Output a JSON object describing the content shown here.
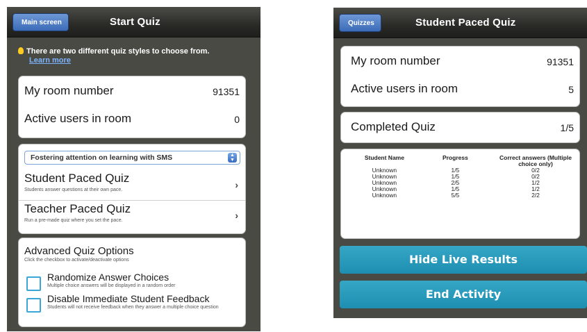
{
  "left_screen": {
    "nav": {
      "back_label": "Main screen",
      "title": "Start Quiz"
    },
    "tip": {
      "text": "There are two different quiz styles to choose from.",
      "link": "Learn more"
    },
    "room": {
      "room_number_label": "My room number",
      "room_number_value": "91351",
      "active_users_label": "Active users in room",
      "active_users_value": "0"
    },
    "quiz_select": {
      "selected": "Fostering attention on learning with SMS"
    },
    "student_paced": {
      "title": "Student Paced Quiz",
      "subtitle": "Students answer questions at their own pace."
    },
    "teacher_paced": {
      "title": "Teacher Paced Quiz",
      "subtitle": "Run a pre-made quiz where you set the pace."
    },
    "advanced": {
      "title": "Advanced Quiz Options",
      "subtitle": "Click the checkbox to activate/deactivate options",
      "options": [
        {
          "title": "Randomize Answer Choices",
          "desc": "Multiple choice answers will be displayed in a random order",
          "checked": false
        },
        {
          "title": "Disable Immediate Student Feedback",
          "desc": "Students will not receive feedback when they answer a multiple choice question",
          "checked": false
        }
      ]
    }
  },
  "right_screen": {
    "nav": {
      "back_label": "Quizzes",
      "title": "Student Paced Quiz"
    },
    "room": {
      "room_number_label": "My room number",
      "room_number_value": "91351",
      "active_users_label": "Active users in room",
      "active_users_value": "5"
    },
    "completed": {
      "label": "Completed Quiz",
      "value": "1/5"
    },
    "results": {
      "headers": [
        "Student Name",
        "Progress",
        "Correct answers (Multiple choice only)"
      ],
      "rows": [
        [
          "Unknown",
          "1/5",
          "0/2"
        ],
        [
          "Unknown",
          "1/5",
          "0/2"
        ],
        [
          "Unknown",
          "2/5",
          "1/2"
        ],
        [
          "Unknown",
          "1/5",
          "1/2"
        ],
        [
          "Unknown",
          "5/5",
          "2/2"
        ]
      ]
    },
    "hide_results_label": "Hide Live Results",
    "end_activity_label": "End Activity"
  },
  "colors": {
    "nav_back_button": "#3c6cb8",
    "action_button": "#2a9cbd",
    "checkbox_border": "#3aa6d8",
    "tip_link": "#7db4ff",
    "bulb": "#ffcc22"
  }
}
